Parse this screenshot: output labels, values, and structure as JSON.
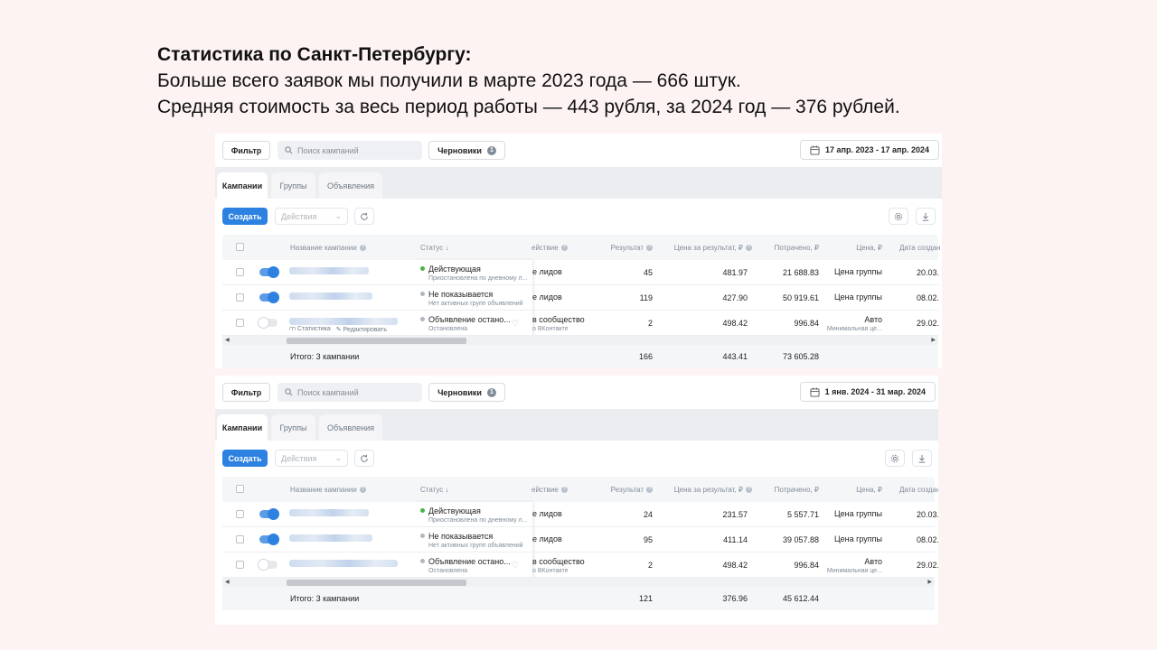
{
  "headline": {
    "title": "Статистика по Санкт-Петербургу:",
    "line1": "Больше всего заявок мы получили в марте 2023 года — 666 штук.",
    "line2": "Средняя стоимость за весь период работы — 443 рубля, за 2024 год — 376 рублей."
  },
  "ui": {
    "filter_label": "Фильтр",
    "search_placeholder": "Поиск кампаний",
    "drafts_label": "Черновики",
    "drafts_count": "1",
    "tabs": [
      "Кампании",
      "Группы",
      "Объявления"
    ],
    "create_label": "Создать",
    "actions_label": "Действия",
    "columns": {
      "name": "Название кампании",
      "status": "Статус ↓",
      "action": "ействие",
      "result": "Результат",
      "price": "Цена за результат, ₽",
      "spent": "Потрачено, ₽",
      "bid": "Цена, ₽",
      "date": "Дата создан"
    },
    "row_actions": [
      "Статистика",
      "Редактировать"
    ]
  },
  "panels": [
    {
      "date_range": "17 апр. 2023 - 17 апр. 2024",
      "rows": [
        {
          "status": "Действующая",
          "status_sub": "Приостановлена по дневному л...",
          "action": "е лидов",
          "action_sub": "",
          "result": "45",
          "price": "481.97",
          "spent": "21 688.83",
          "bid": "Цена группы",
          "bid_sub": "",
          "date": "20.03."
        },
        {
          "status": "Не показывается",
          "status_sub": "Нет активных групп объявлений",
          "action": "е лидов",
          "action_sub": "",
          "result": "119",
          "price": "427.90",
          "spent": "50 919.61",
          "bid": "Цена группы",
          "bid_sub": "",
          "date": "08.02."
        },
        {
          "status": "Объявление остано...",
          "status_sub": "Остановлена",
          "action": "в сообщество",
          "action_sub": "о ВКонтакте",
          "result": "2",
          "price": "498.42",
          "spent": "996.84",
          "bid": "Авто",
          "bid_sub": "Минимальная це...",
          "date": "29.02."
        }
      ],
      "total_label": "Итого: 3 кампании",
      "total_result": "166",
      "total_price": "443.41",
      "total_spent": "73 605.28"
    },
    {
      "date_range": "1 янв. 2024 - 31 мар. 2024",
      "rows": [
        {
          "status": "Действующая",
          "status_sub": "Приостановлена по дневному л...",
          "action": "е лидов",
          "action_sub": "",
          "result": "24",
          "price": "231.57",
          "spent": "5 557.71",
          "bid": "Цена группы",
          "bid_sub": "",
          "date": "20.03."
        },
        {
          "status": "Не показывается",
          "status_sub": "Нет активных групп объявлений",
          "action": "е лидов",
          "action_sub": "",
          "result": "95",
          "price": "411.14",
          "spent": "39 057.88",
          "bid": "Цена группы",
          "bid_sub": "",
          "date": "08.02."
        },
        {
          "status": "Объявление остано...",
          "status_sub": "Остановлена",
          "action": "в сообщество",
          "action_sub": "о ВКонтакте",
          "result": "2",
          "price": "498.42",
          "spent": "996.84",
          "bid": "Авто",
          "bid_sub": "Минимальная це...",
          "date": "29.02."
        }
      ],
      "total_label": "Итого: 3 кампании",
      "total_result": "121",
      "total_price": "376.96",
      "total_spent": "45 612.44"
    }
  ],
  "colors": {
    "accent": "#2d81e0",
    "status_active": "#4bb34b",
    "status_inactive": "#aeb7c2"
  }
}
